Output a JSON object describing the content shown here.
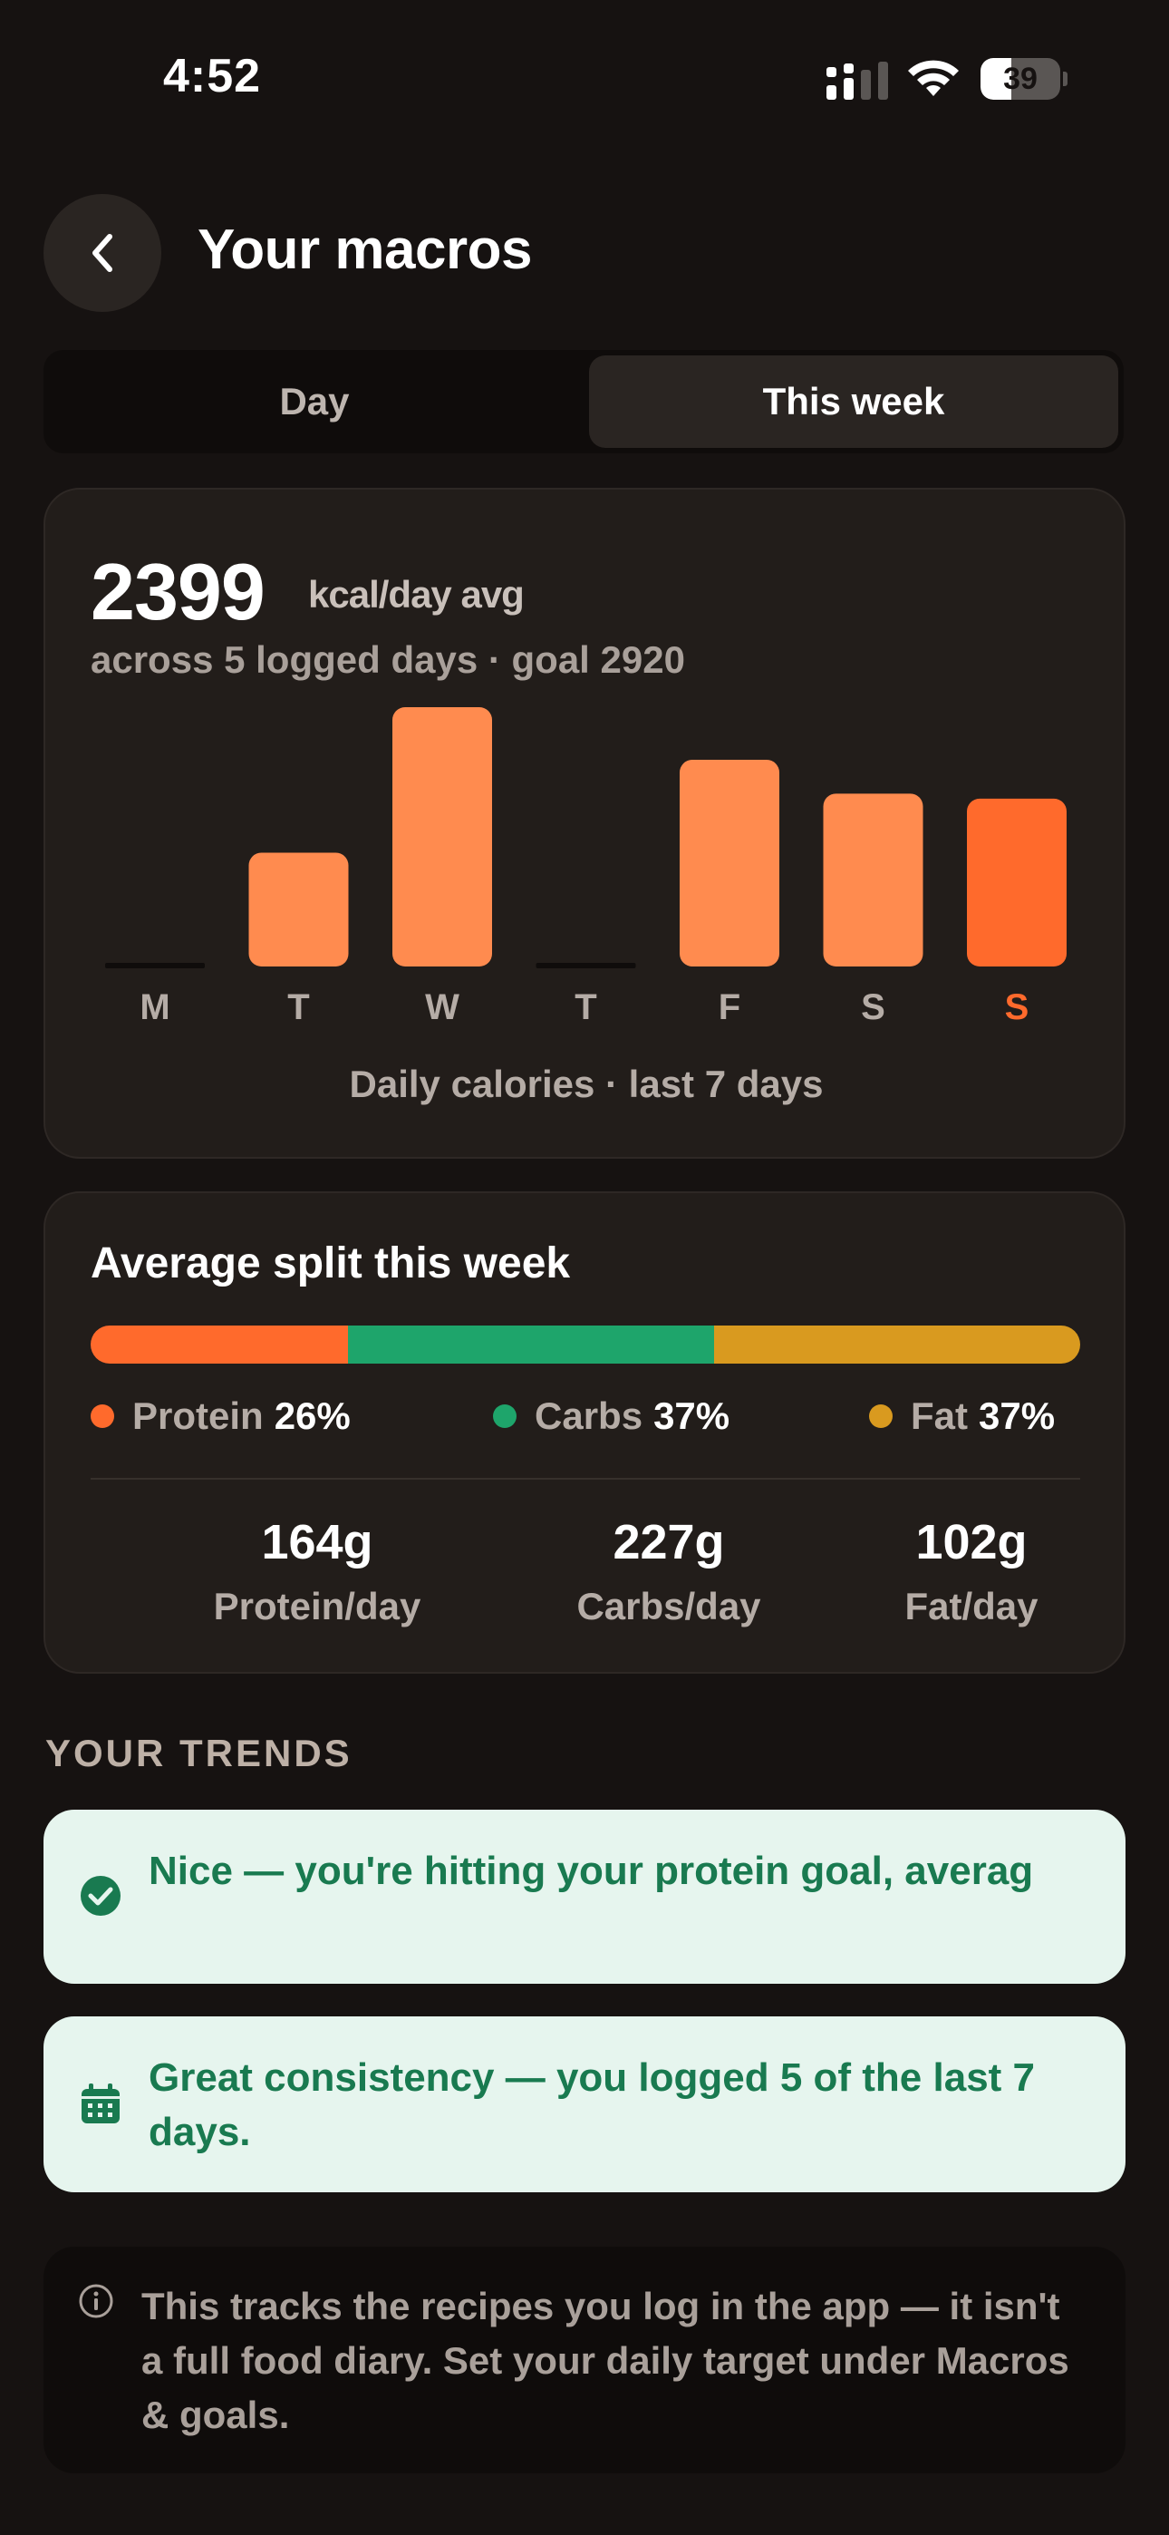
{
  "status_bar": {
    "time": "4:52",
    "battery": "39",
    "battery_level": 0.39
  },
  "header": {
    "title": "Your macros"
  },
  "tabs": [
    {
      "label": "Day",
      "selected": false
    },
    {
      "label": "This week",
      "selected": true
    }
  ],
  "calories": {
    "avg_value": "2399",
    "avg_unit": "kcal/day avg",
    "subtitle": "across 5 logged days · goal 2920",
    "caption": "Daily calories · last 7 days"
  },
  "chart_data": {
    "type": "bar",
    "categories": [
      "M",
      "T",
      "W",
      "T",
      "F",
      "S",
      "S"
    ],
    "values": [
      0,
      1580,
      3600,
      0,
      2870,
      2400,
      2330
    ],
    "logged": [
      false,
      true,
      true,
      false,
      true,
      true,
      true
    ],
    "today_index": 6,
    "ylim": [
      0,
      3600
    ],
    "colors": {
      "bar": "#ff8b4f",
      "today": "#ff6a2c",
      "empty": "#0f0c0b",
      "label": "#b5aca6"
    }
  },
  "split": {
    "title": "Average split this week",
    "macros": [
      {
        "name": "Protein",
        "pct_label": "26%",
        "pct": 26,
        "color": "#ff6a2c"
      },
      {
        "name": "Carbs",
        "pct_label": "37%",
        "pct": 37,
        "color": "#1ea56b"
      },
      {
        "name": "Fat",
        "pct_label": "37%",
        "pct": 37,
        "color": "#d99a1f"
      }
    ],
    "stats": [
      {
        "value": "164g",
        "label": "Protein/day"
      },
      {
        "value": "227g",
        "label": "Carbs/day"
      },
      {
        "value": "102g",
        "label": "Fat/day"
      }
    ]
  },
  "trends": {
    "heading": "YOUR TRENDS",
    "items": [
      {
        "icon": "check-circle-icon",
        "text": "Nice — you're hitting your protein goal, averag"
      },
      {
        "icon": "calendar-icon",
        "text": "Great consistency — you logged 5 of the last 7 days."
      }
    ]
  },
  "note": {
    "icon": "info-icon",
    "text": "This tracks the recipes you log in the app — it isn't a full food diary. Set your daily target under Macros & goals."
  }
}
